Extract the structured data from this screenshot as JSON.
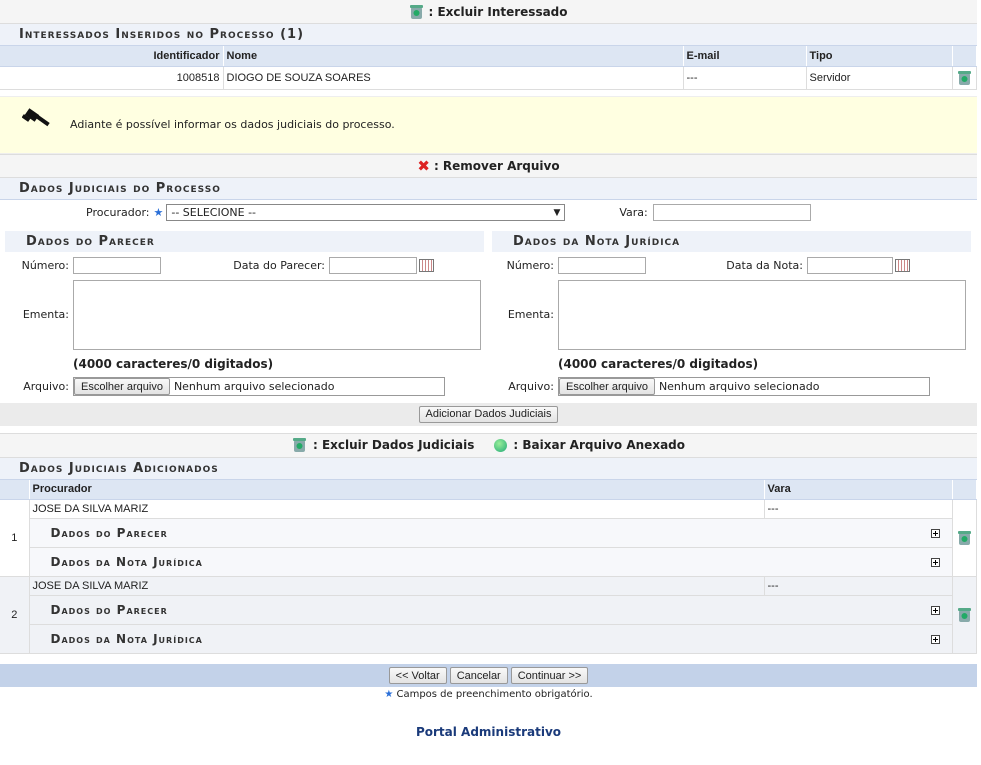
{
  "legend_top": {
    "label": ": Excluir Interessado"
  },
  "interessados": {
    "title": "Interessados Inseridos no Processo (1)",
    "columns": [
      "Identificador",
      "Nome",
      "E-mail",
      "Tipo"
    ],
    "rows": [
      {
        "id": "1008518",
        "nome": "DIOGO DE SOUZA SOARES",
        "email": "---",
        "tipo": "Servidor"
      }
    ]
  },
  "info": {
    "text": "Adiante é possível informar os dados judiciais do processo."
  },
  "legend_remove": {
    "label": ": Remover Arquivo"
  },
  "dados_judiciais": {
    "title": "Dados Judiciais do Processo",
    "procurador_label": "Procurador:",
    "procurador_value": "-- SELECIONE --",
    "vara_label": "Vara:",
    "vara_value": ""
  },
  "parecer": {
    "title": "Dados do Parecer",
    "numero_label": "Número:",
    "data_label": "Data do Parecer:",
    "ementa_label": "Ementa:",
    "counter": "(4000 caracteres/0 digitados)",
    "arquivo_label": "Arquivo:",
    "file_button": "Escolher arquivo",
    "file_status": "Nenhum arquivo selecionado"
  },
  "nota": {
    "title": "Dados da Nota Jurídica",
    "numero_label": "Número:",
    "data_label": "Data da Nota:",
    "ementa_label": "Ementa:",
    "counter": "(4000 caracteres/0 digitados)",
    "arquivo_label": "Arquivo:",
    "file_button": "Escolher arquivo",
    "file_status": "Nenhum arquivo selecionado"
  },
  "add_button": "Adicionar Dados Judiciais",
  "legend_dados": {
    "excluir": ": Excluir Dados Judiciais",
    "baixar": ": Baixar Arquivo Anexado"
  },
  "adicionados": {
    "title": "Dados Judiciais Adicionados",
    "columns": [
      "Procurador",
      "Vara"
    ],
    "sub_parecer": "Dados do Parecer",
    "sub_nota": "Dados da Nota Jurídica",
    "rows": [
      {
        "num": "1",
        "procurador": "JOSE DA SILVA MARIZ",
        "vara": "---"
      },
      {
        "num": "2",
        "procurador": "JOSE DA SILVA MARIZ",
        "vara": "---"
      }
    ]
  },
  "footer": {
    "voltar": "<< Voltar",
    "cancelar": "Cancelar",
    "continuar": "Continuar >>",
    "required_note": "Campos de preenchimento obrigatório.",
    "portal": "Portal Administrativo"
  },
  "colors": {
    "header_blue": "#dde6f3",
    "section_bg": "#eef2f9",
    "info_yellow": "#ffffe1",
    "footer_blue": "#c3d2e9",
    "link_blue": "#1a3a7a"
  }
}
